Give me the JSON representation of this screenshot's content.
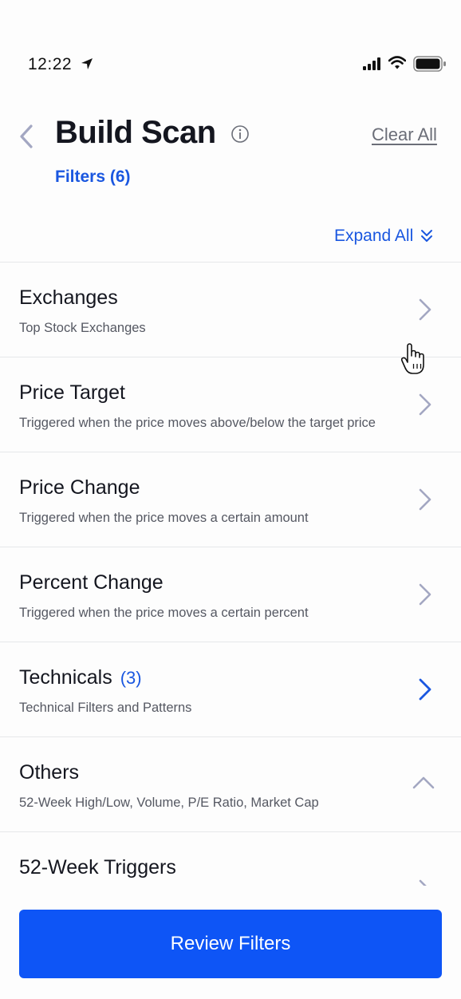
{
  "status": {
    "time": "12:22"
  },
  "header": {
    "title": "Build Scan",
    "clear_all": "Clear All",
    "filters_count": "Filters (6)",
    "expand_all": "Expand All"
  },
  "filters": [
    {
      "title": "Exchanges",
      "count": "",
      "subtitle": "Top Stock Exchanges",
      "state": "collapsed"
    },
    {
      "title": "Price Target",
      "count": "",
      "subtitle": "Triggered when the price moves above/below the target price",
      "state": "collapsed"
    },
    {
      "title": "Price Change",
      "count": "",
      "subtitle": "Triggered when the price moves a certain amount",
      "state": "collapsed"
    },
    {
      "title": "Percent Change",
      "count": "",
      "subtitle": "Triggered when the price moves a certain percent",
      "state": "collapsed"
    },
    {
      "title": "Technicals",
      "count": "(3)",
      "subtitle": "Technical Filters and Patterns",
      "state": "active"
    },
    {
      "title": "Others",
      "count": "",
      "subtitle": "52-Week High/Low, Volume, P/E Ratio, Market Cap",
      "state": "expanded"
    },
    {
      "title": "52-Week Triggers",
      "count": "",
      "subtitle": "",
      "state": "collapsed"
    }
  ],
  "footer": {
    "review_button": "Review Filters"
  },
  "colors": {
    "accent": "#1a57e0",
    "button": "#0e55f6",
    "chevron": "#a3a7c2"
  },
  "icons": [
    "location-arrow-icon",
    "signal-icon",
    "wifi-icon",
    "battery-icon",
    "back-chevron-icon",
    "info-icon",
    "double-chevron-down-icon",
    "chevron-right-icon",
    "chevron-up-icon",
    "hand-cursor-icon"
  ]
}
